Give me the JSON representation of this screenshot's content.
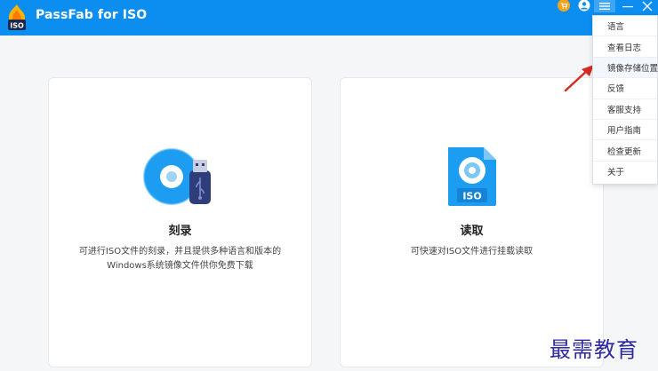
{
  "app": {
    "title": "PassFab for ISO",
    "logo_badge": "ISO",
    "accent": "#0b8ef0"
  },
  "titlebar_icons": [
    "cart-icon",
    "user-icon",
    "hamburger-menu-icon",
    "minimize-icon",
    "close-icon"
  ],
  "cards": [
    {
      "title": "刻录",
      "desc_lines": [
        "可进行ISO文件的刻录，并且提供多种语言和版本的",
        "Windows系统镜像文件供你免费下载"
      ]
    },
    {
      "title": "读取",
      "desc_lines": [
        "可快速对ISO文件进行挂载读取"
      ],
      "file_label": "ISO"
    }
  ],
  "menu": {
    "items": [
      {
        "label": "语言"
      },
      {
        "label": "查看日志"
      },
      {
        "label": "镜像存储位置"
      },
      {
        "label": "反馈"
      },
      {
        "label": "客服支持"
      },
      {
        "label": "用户指南"
      },
      {
        "label": "检查更新"
      },
      {
        "label": "关于"
      }
    ]
  },
  "watermark": "最需教育"
}
